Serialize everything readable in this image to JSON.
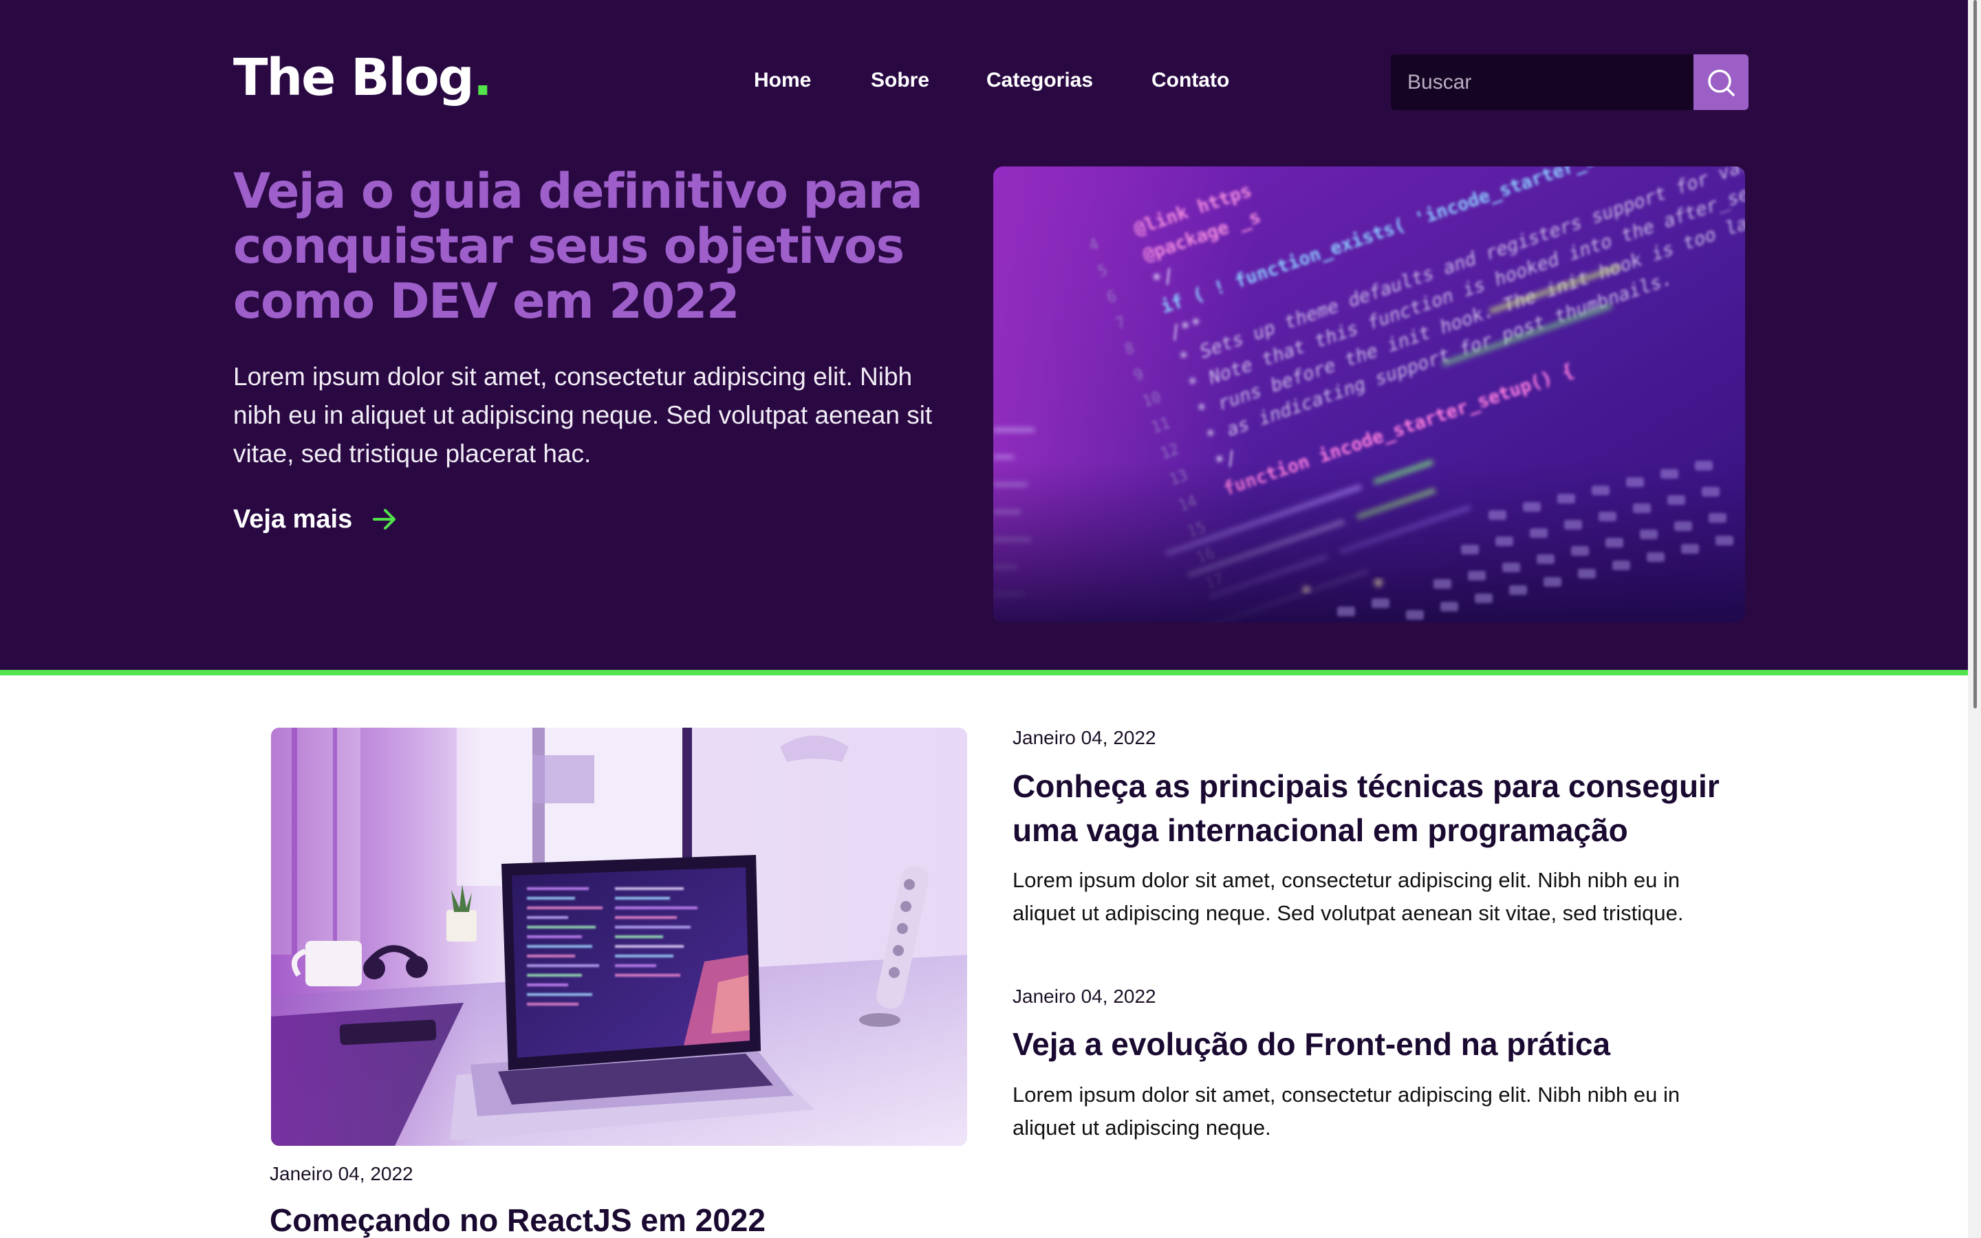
{
  "header": {
    "logo_text": "The Blog",
    "logo_dot": ".",
    "nav": [
      {
        "label": "Home"
      },
      {
        "label": "Sobre"
      },
      {
        "label": "Categorias"
      },
      {
        "label": "Contato"
      }
    ],
    "search": {
      "placeholder": "Buscar"
    }
  },
  "hero": {
    "title": "Veja o guia definitivo para conquistar seus objetivos como DEV em 2022",
    "text": "Lorem ipsum dolor sit amet, consectetur adipiscing elit. Nibh nibh eu in aliquet ut adipiscing neque. Sed volutpat aenean sit vitae, sed tristique placerat hac.",
    "cta_label": "Veja mais",
    "image": {
      "code_lines": [
        "@link https",
        "@package _s",
        "*/",
        "if ( ! function_exists( 'incode_starter_setup' ) )",
        "/**",
        " * Sets up theme defaults and registers support for various WordPress",
        " * Note that this function is hooked into the after_setup_theme hook",
        " * runs before the init hook. The init hook is too late for some features",
        " * as indicating support for post thumbnails.",
        " */",
        "function incode_starter_setup() {"
      ],
      "line_numbers": [
        "4",
        "5",
        "6",
        "7",
        "8",
        "9",
        "10",
        "11",
        "12",
        "13",
        "14",
        "15",
        "16",
        "17"
      ]
    }
  },
  "posts": {
    "featured": {
      "date": "Janeiro 04, 2022",
      "title": "Começando no ReactJS em 2022"
    },
    "list": [
      {
        "date": "Janeiro 04, 2022",
        "title": "Conheça as principais técnicas para conseguir uma vaga internacional em programação",
        "text": "Lorem ipsum dolor sit amet, consectetur adipiscing elit. Nibh nibh eu in aliquet ut adipiscing neque. Sed volutpat aenean sit vitae, sed tristique."
      },
      {
        "date": "Janeiro 04, 2022",
        "title": "Veja a evolução do Front-end na prática",
        "text": "Lorem ipsum dolor sit amet, consectetur adipiscing elit. Nibh nibh eu in aliquet ut adipiscing neque."
      }
    ]
  },
  "colors": {
    "hero_bg": "#2a0943",
    "accent_purple": "#9e5fcb",
    "accent_green": "#53e34c",
    "search_button": "#9c5fc6"
  }
}
